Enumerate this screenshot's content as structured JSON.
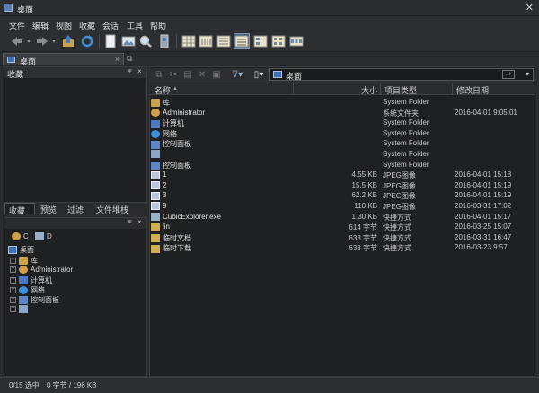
{
  "window": {
    "title": "桌面"
  },
  "menu": [
    "文件",
    "编辑",
    "视图",
    "收藏",
    "会话",
    "工具",
    "帮助"
  ],
  "tab": {
    "label": "桌面",
    "close": "×"
  },
  "fav_panel": {
    "title": "收藏",
    "pin": "ᵠ",
    "close": "×"
  },
  "bottom_tabs": [
    "收藏",
    "预览",
    "过滤",
    "文件堆栈"
  ],
  "tree_panel": {
    "pin": "ᵠ",
    "close": "×"
  },
  "drives": [
    {
      "label": "C"
    },
    {
      "label": "D"
    }
  ],
  "tree": [
    {
      "label": "桌面",
      "icon": "desktop-icon",
      "level": 0
    },
    {
      "label": "库",
      "icon": "folder-icon",
      "level": 1
    },
    {
      "label": "Administrator",
      "icon": "user-icon",
      "level": 1
    },
    {
      "label": "计算机",
      "icon": "computer-icon",
      "level": 1
    },
    {
      "label": "网络",
      "icon": "network-icon",
      "level": 1
    },
    {
      "label": "控制面板",
      "icon": "control-panel-icon",
      "level": 1
    },
    {
      "label": "",
      "icon": "recycle-bin-icon",
      "level": 1
    }
  ],
  "address": {
    "value": "桌面",
    "go": "..›"
  },
  "columns": {
    "name": "名称",
    "size": "大小",
    "type": "项目类型",
    "date": "修改日期"
  },
  "files": [
    {
      "name": "库",
      "size": "",
      "type": "System Folder",
      "date": "",
      "icon": "folder-icon"
    },
    {
      "name": "Administrator",
      "size": "",
      "type": "系统文件夹",
      "date": "2016-04-01 9:05:01",
      "icon": "user-icon"
    },
    {
      "name": "计算机",
      "size": "",
      "type": "System Folder",
      "date": "",
      "icon": "computer-icon"
    },
    {
      "name": "网络",
      "size": "",
      "type": "System Folder",
      "date": "",
      "icon": "network-icon"
    },
    {
      "name": "控制面板",
      "size": "",
      "type": "System Folder",
      "date": "",
      "icon": "control-panel-icon"
    },
    {
      "name": "",
      "size": "",
      "type": "System Folder",
      "date": "",
      "icon": "recycle-bin-icon"
    },
    {
      "name": "控制面板",
      "size": "",
      "type": "System Folder",
      "date": "",
      "icon": "control-panel-icon"
    },
    {
      "name": "1",
      "size": "4.55 KB",
      "type": "JPEG图像",
      "date": "2016-04-01 15:18",
      "icon": "image-icon"
    },
    {
      "name": "2",
      "size": "15.5 KB",
      "type": "JPEG图像",
      "date": "2016-04-01 15:19",
      "icon": "image-icon"
    },
    {
      "name": "3",
      "size": "62.2 KB",
      "type": "JPEG图像",
      "date": "2016-04-01 15:19",
      "icon": "image-icon"
    },
    {
      "name": "9",
      "size": "110 KB",
      "type": "JPEG图像",
      "date": "2016-03-31 17:02",
      "icon": "image-icon"
    },
    {
      "name": "CubicExplorer.exe",
      "size": "1.30 KB",
      "type": "快捷方式",
      "date": "2016-04-01 15:17",
      "icon": "exe-icon"
    },
    {
      "name": "lin",
      "size": "614 字节",
      "type": "快捷方式",
      "date": "2016-03-25 15:07",
      "icon": "shortcut-icon"
    },
    {
      "name": "临时文档",
      "size": "633 字节",
      "type": "快捷方式",
      "date": "2016-03-31 16:47",
      "icon": "shortcut-icon"
    },
    {
      "name": "临时下载",
      "size": "633 字节",
      "type": "快捷方式",
      "date": "2016-03-23 9:57",
      "icon": "shortcut-icon"
    }
  ],
  "status": {
    "selection": "0/15 选中",
    "size": "0 字节 / 196 KB"
  }
}
